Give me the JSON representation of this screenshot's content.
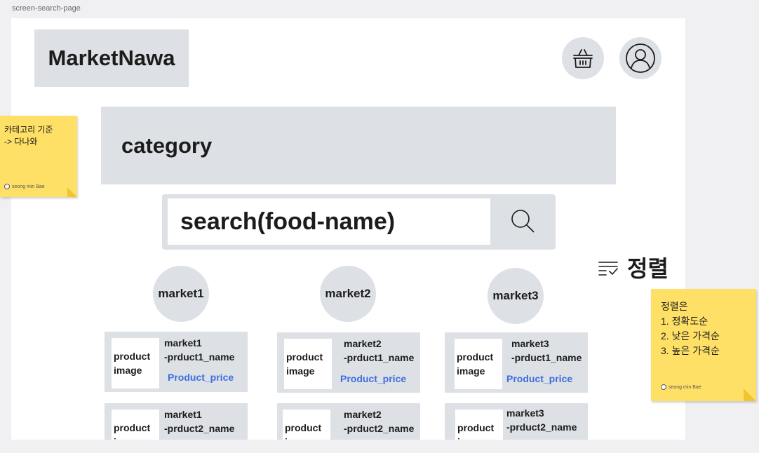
{
  "frame_label": "screen-search-page",
  "header": {
    "logo_text": "MarketNawa",
    "cart_icon": "basket-icon",
    "profile_icon": "user-avatar-icon"
  },
  "category_label": "category",
  "search": {
    "value": "search(food-name)",
    "button_icon": "search-icon"
  },
  "sort": {
    "icon": "sort-list-icon",
    "label": "정렬"
  },
  "markets": [
    {
      "name": "market1",
      "products": [
        {
          "image_label_1": "product",
          "image_label_2": "image",
          "name_line_1": "market1",
          "name_line_2": "-prduct1_name",
          "price": "Product_price"
        },
        {
          "image_label_1": "product",
          "image_label_2": "image",
          "name_line_1": "market1",
          "name_line_2": "-prduct2_name"
        }
      ]
    },
    {
      "name": "market2",
      "products": [
        {
          "image_label_1": "product",
          "image_label_2": "image",
          "name_line_1": "market2",
          "name_line_2": "-prduct1_name",
          "price": "Product_price"
        },
        {
          "image_label_1": "product",
          "image_label_2": "image",
          "name_line_1": "market2",
          "name_line_2": "-prduct2_name"
        }
      ]
    },
    {
      "name": "market3",
      "products": [
        {
          "image_label_1": "product",
          "image_label_2": "image",
          "name_line_1": "market3",
          "name_line_2": "-prduct1_name",
          "price": "Product_price"
        },
        {
          "image_label_1": "product",
          "image_label_2": "image",
          "name_line_1": "market3",
          "name_line_2": "-prduct2_name"
        }
      ]
    }
  ],
  "sticky_notes": [
    {
      "line_1": "카테고리 기준",
      "line_2": "-> 다나와",
      "author": "seong min Bae"
    },
    {
      "line_1": "정렬은",
      "line_2": "1.  정확도순",
      "line_3": "2.  낮은 가격순",
      "line_4": "3.  높은 가격순",
      "author": "seong min Bae"
    }
  ],
  "colors": {
    "canvas": "#f0f0f2",
    "placeholder_gray": "#dde0e4",
    "price_blue": "#3d6fe0",
    "sticky_yellow": "#ffe066"
  }
}
